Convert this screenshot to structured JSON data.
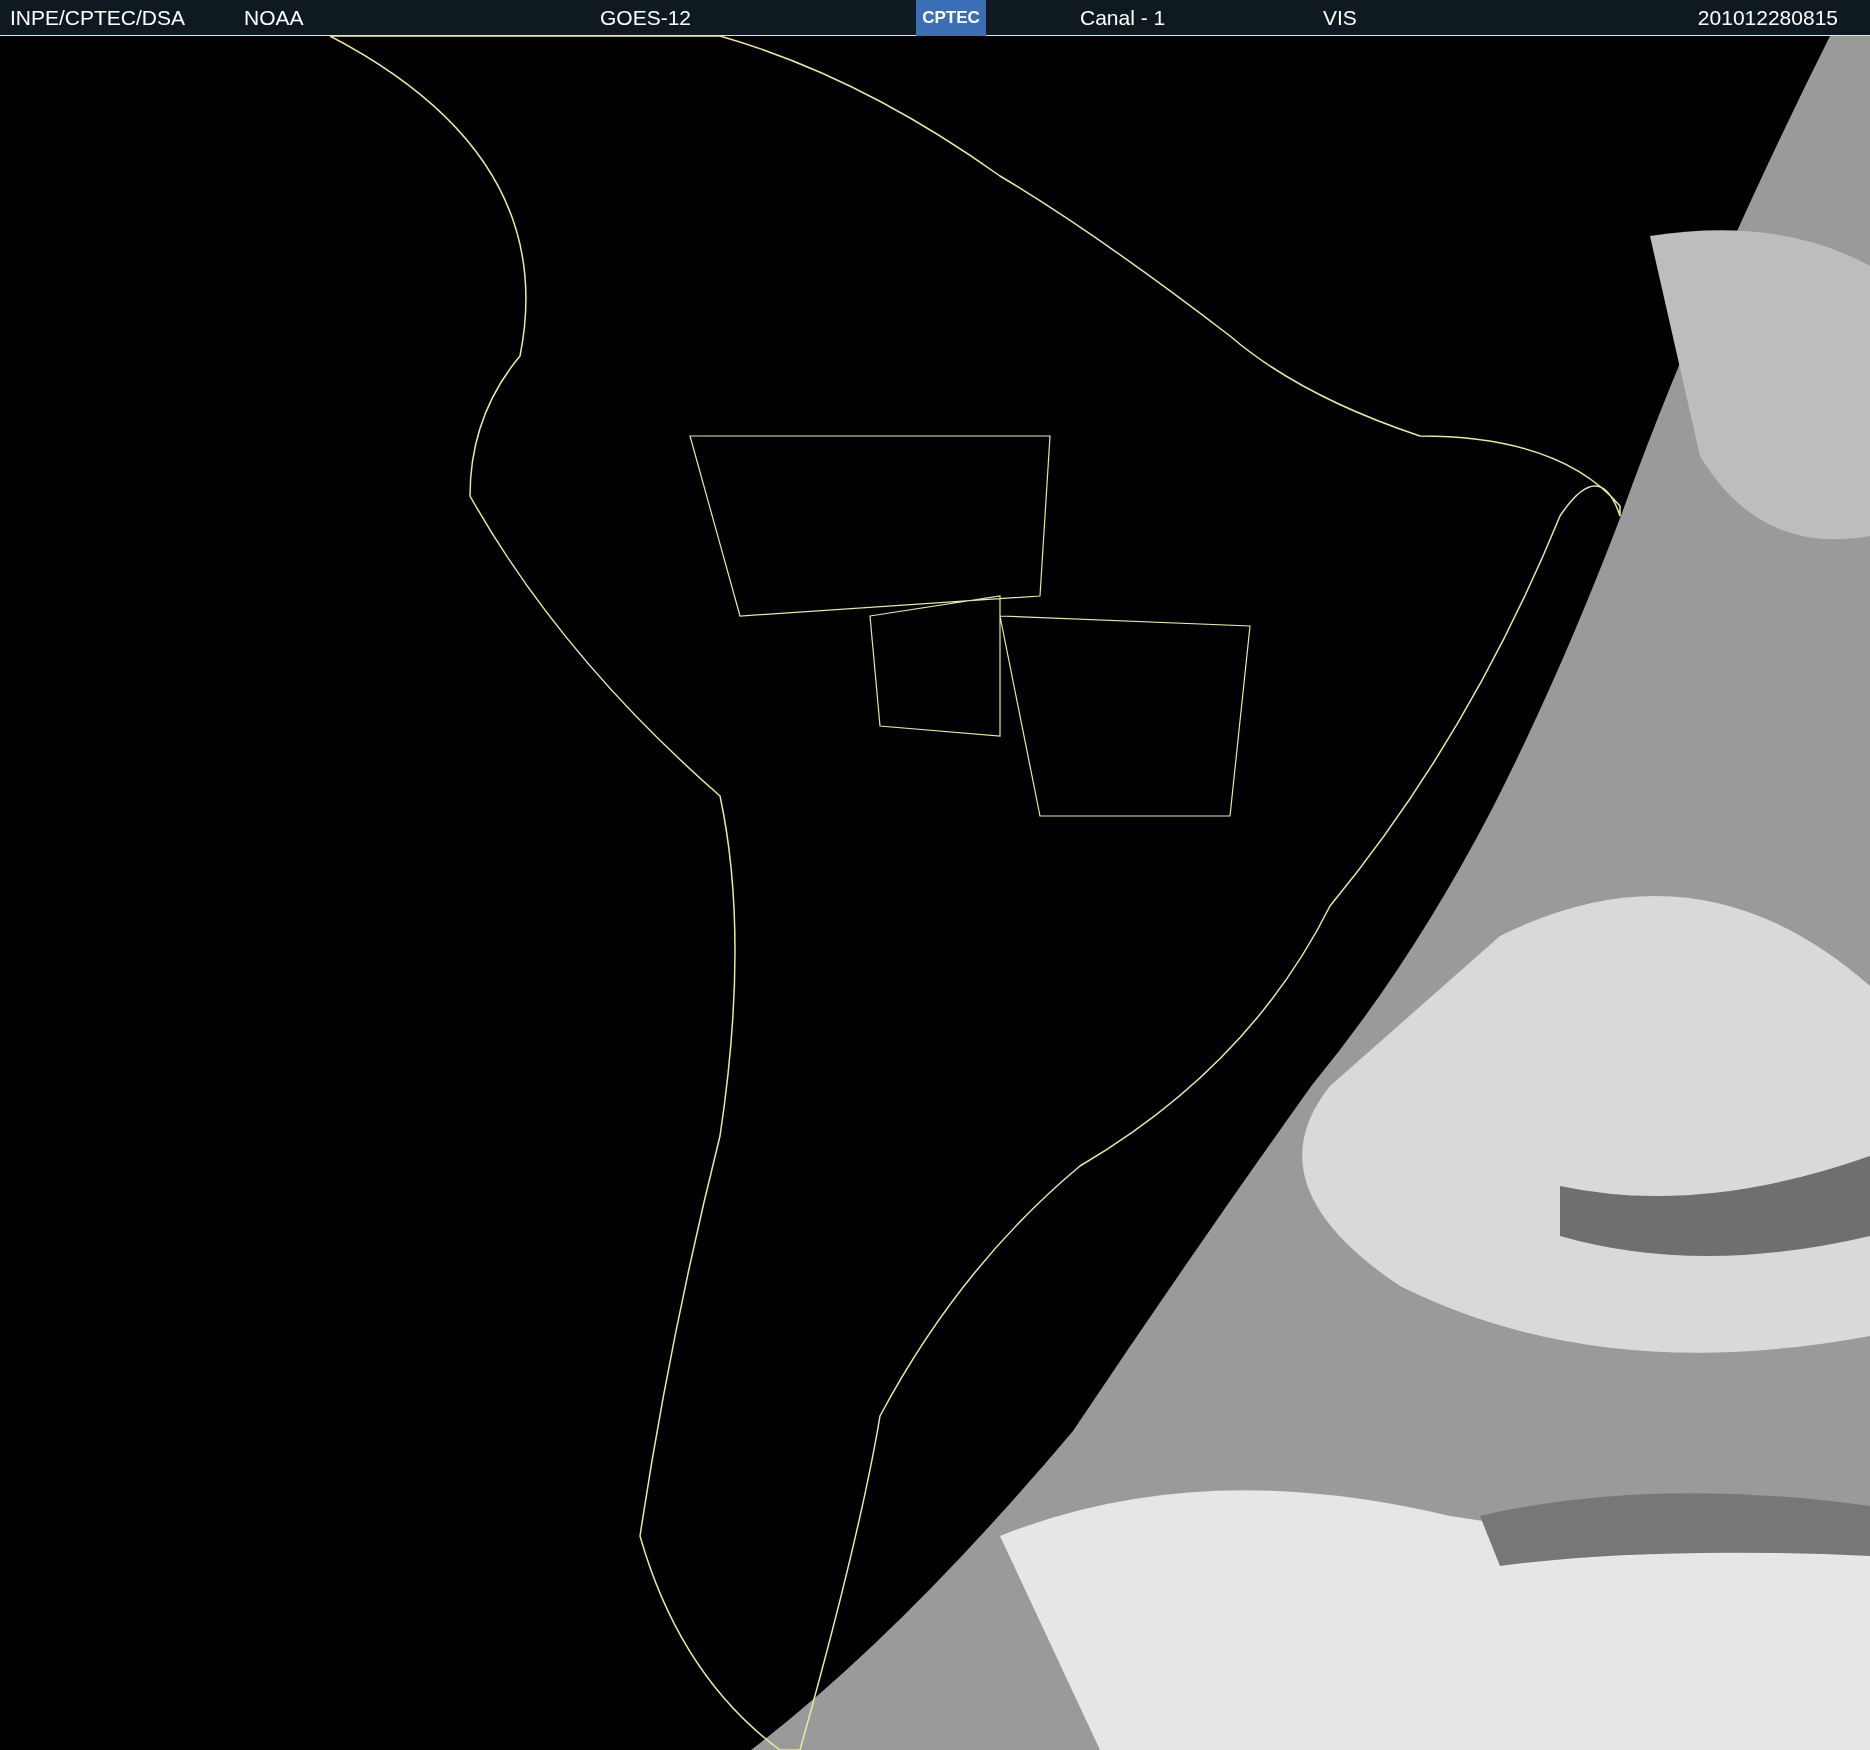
{
  "header": {
    "source": "INPE/CPTEC/DSA",
    "agency": "NOAA",
    "satellite": "GOES-12",
    "logo": "CPTEC",
    "channel": "Canal - 1",
    "band": "VIS",
    "timestamp": "201012280815"
  }
}
